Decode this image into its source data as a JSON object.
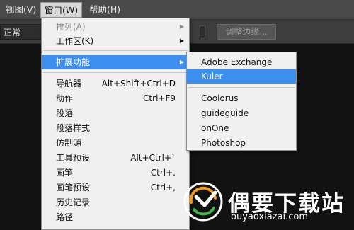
{
  "menubar": {
    "items": [
      "视图(V)",
      "窗口(W)",
      "帮助(H)"
    ]
  },
  "options": {
    "mode": "正常",
    "refine_button": "调整边缘..."
  },
  "window_menu": {
    "items": [
      {
        "label": "排列(A)",
        "shortcut": "",
        "submenu": true,
        "disabled": true
      },
      {
        "label": "工作区(K)",
        "shortcut": "",
        "submenu": true
      },
      {
        "label": "扩展功能",
        "shortcut": "",
        "submenu": true,
        "highlight": true
      },
      {
        "label": "导航器",
        "shortcut": "Alt+Shift+Ctrl+D"
      },
      {
        "label": "动作",
        "shortcut": "Ctrl+F9"
      },
      {
        "label": "段落",
        "shortcut": ""
      },
      {
        "label": "段落样式",
        "shortcut": ""
      },
      {
        "label": "仿制源",
        "shortcut": ""
      },
      {
        "label": "工具预设",
        "shortcut": "Alt+Ctrl+`"
      },
      {
        "label": "画笔",
        "shortcut": "Ctrl+."
      },
      {
        "label": "画笔预设",
        "shortcut": "Ctrl+,"
      },
      {
        "label": "历史记录",
        "shortcut": ""
      },
      {
        "label": "路径",
        "shortcut": ""
      }
    ]
  },
  "extensions_menu": {
    "items": [
      "Adobe Exchange",
      "Kuler",
      "Coolorus",
      "guideguide",
      "onOne",
      "Photoshop"
    ],
    "highlighted": "Kuler"
  },
  "watermark": {
    "title": "偶要下载站",
    "url": "ouyaoxiazai.com"
  },
  "colors": {
    "highlight": "#3d8fef",
    "menu_bg": "#f0f0f0",
    "canvas_bg": "#121212"
  }
}
